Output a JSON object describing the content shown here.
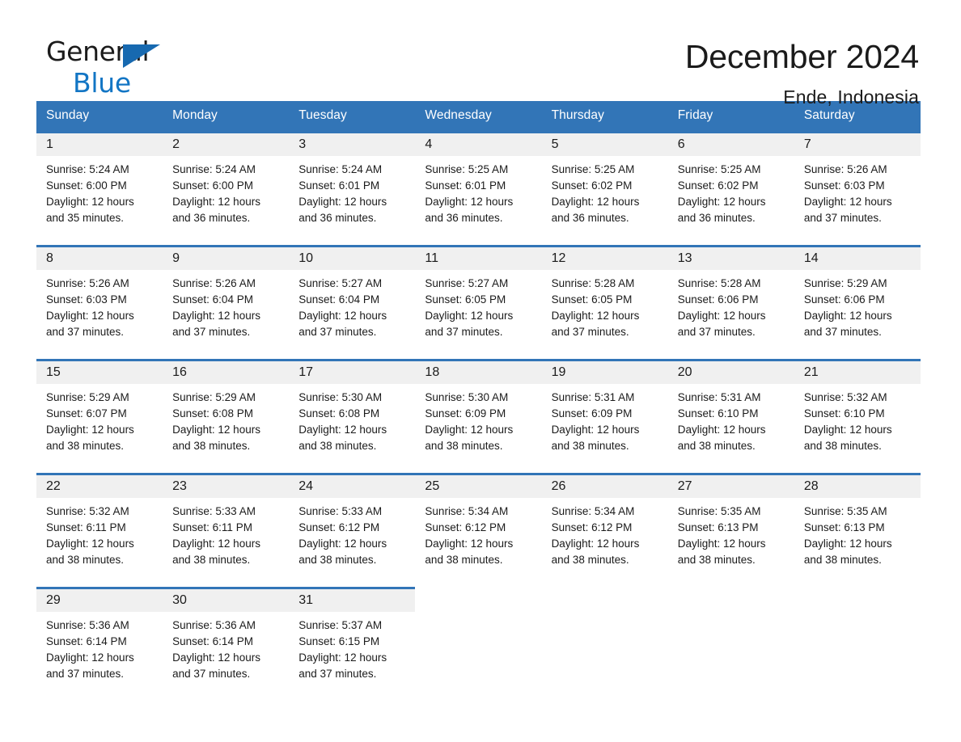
{
  "brand": {
    "name_top": "General",
    "name_bottom": "Blue",
    "accent_color": "#1275c4",
    "triangle_color": "#1769b0"
  },
  "header": {
    "month_title": "December 2024",
    "location": "Ende, Indonesia"
  },
  "calendar": {
    "header_bg": "#3275b7",
    "header_text_color": "#ffffff",
    "daynum_bg": "#f0f0f0",
    "weekdays": [
      "Sunday",
      "Monday",
      "Tuesday",
      "Wednesday",
      "Thursday",
      "Friday",
      "Saturday"
    ],
    "weeks": [
      [
        {
          "day": "1",
          "sunrise": "Sunrise: 5:24 AM",
          "sunset": "Sunset: 6:00 PM",
          "daylight_line1": "Daylight: 12 hours",
          "daylight_line2": "and 35 minutes."
        },
        {
          "day": "2",
          "sunrise": "Sunrise: 5:24 AM",
          "sunset": "Sunset: 6:00 PM",
          "daylight_line1": "Daylight: 12 hours",
          "daylight_line2": "and 36 minutes."
        },
        {
          "day": "3",
          "sunrise": "Sunrise: 5:24 AM",
          "sunset": "Sunset: 6:01 PM",
          "daylight_line1": "Daylight: 12 hours",
          "daylight_line2": "and 36 minutes."
        },
        {
          "day": "4",
          "sunrise": "Sunrise: 5:25 AM",
          "sunset": "Sunset: 6:01 PM",
          "daylight_line1": "Daylight: 12 hours",
          "daylight_line2": "and 36 minutes."
        },
        {
          "day": "5",
          "sunrise": "Sunrise: 5:25 AM",
          "sunset": "Sunset: 6:02 PM",
          "daylight_line1": "Daylight: 12 hours",
          "daylight_line2": "and 36 minutes."
        },
        {
          "day": "6",
          "sunrise": "Sunrise: 5:25 AM",
          "sunset": "Sunset: 6:02 PM",
          "daylight_line1": "Daylight: 12 hours",
          "daylight_line2": "and 36 minutes."
        },
        {
          "day": "7",
          "sunrise": "Sunrise: 5:26 AM",
          "sunset": "Sunset: 6:03 PM",
          "daylight_line1": "Daylight: 12 hours",
          "daylight_line2": "and 37 minutes."
        }
      ],
      [
        {
          "day": "8",
          "sunrise": "Sunrise: 5:26 AM",
          "sunset": "Sunset: 6:03 PM",
          "daylight_line1": "Daylight: 12 hours",
          "daylight_line2": "and 37 minutes."
        },
        {
          "day": "9",
          "sunrise": "Sunrise: 5:26 AM",
          "sunset": "Sunset: 6:04 PM",
          "daylight_line1": "Daylight: 12 hours",
          "daylight_line2": "and 37 minutes."
        },
        {
          "day": "10",
          "sunrise": "Sunrise: 5:27 AM",
          "sunset": "Sunset: 6:04 PM",
          "daylight_line1": "Daylight: 12 hours",
          "daylight_line2": "and 37 minutes."
        },
        {
          "day": "11",
          "sunrise": "Sunrise: 5:27 AM",
          "sunset": "Sunset: 6:05 PM",
          "daylight_line1": "Daylight: 12 hours",
          "daylight_line2": "and 37 minutes."
        },
        {
          "day": "12",
          "sunrise": "Sunrise: 5:28 AM",
          "sunset": "Sunset: 6:05 PM",
          "daylight_line1": "Daylight: 12 hours",
          "daylight_line2": "and 37 minutes."
        },
        {
          "day": "13",
          "sunrise": "Sunrise: 5:28 AM",
          "sunset": "Sunset: 6:06 PM",
          "daylight_line1": "Daylight: 12 hours",
          "daylight_line2": "and 37 minutes."
        },
        {
          "day": "14",
          "sunrise": "Sunrise: 5:29 AM",
          "sunset": "Sunset: 6:06 PM",
          "daylight_line1": "Daylight: 12 hours",
          "daylight_line2": "and 37 minutes."
        }
      ],
      [
        {
          "day": "15",
          "sunrise": "Sunrise: 5:29 AM",
          "sunset": "Sunset: 6:07 PM",
          "daylight_line1": "Daylight: 12 hours",
          "daylight_line2": "and 38 minutes."
        },
        {
          "day": "16",
          "sunrise": "Sunrise: 5:29 AM",
          "sunset": "Sunset: 6:08 PM",
          "daylight_line1": "Daylight: 12 hours",
          "daylight_line2": "and 38 minutes."
        },
        {
          "day": "17",
          "sunrise": "Sunrise: 5:30 AM",
          "sunset": "Sunset: 6:08 PM",
          "daylight_line1": "Daylight: 12 hours",
          "daylight_line2": "and 38 minutes."
        },
        {
          "day": "18",
          "sunrise": "Sunrise: 5:30 AM",
          "sunset": "Sunset: 6:09 PM",
          "daylight_line1": "Daylight: 12 hours",
          "daylight_line2": "and 38 minutes."
        },
        {
          "day": "19",
          "sunrise": "Sunrise: 5:31 AM",
          "sunset": "Sunset: 6:09 PM",
          "daylight_line1": "Daylight: 12 hours",
          "daylight_line2": "and 38 minutes."
        },
        {
          "day": "20",
          "sunrise": "Sunrise: 5:31 AM",
          "sunset": "Sunset: 6:10 PM",
          "daylight_line1": "Daylight: 12 hours",
          "daylight_line2": "and 38 minutes."
        },
        {
          "day": "21",
          "sunrise": "Sunrise: 5:32 AM",
          "sunset": "Sunset: 6:10 PM",
          "daylight_line1": "Daylight: 12 hours",
          "daylight_line2": "and 38 minutes."
        }
      ],
      [
        {
          "day": "22",
          "sunrise": "Sunrise: 5:32 AM",
          "sunset": "Sunset: 6:11 PM",
          "daylight_line1": "Daylight: 12 hours",
          "daylight_line2": "and 38 minutes."
        },
        {
          "day": "23",
          "sunrise": "Sunrise: 5:33 AM",
          "sunset": "Sunset: 6:11 PM",
          "daylight_line1": "Daylight: 12 hours",
          "daylight_line2": "and 38 minutes."
        },
        {
          "day": "24",
          "sunrise": "Sunrise: 5:33 AM",
          "sunset": "Sunset: 6:12 PM",
          "daylight_line1": "Daylight: 12 hours",
          "daylight_line2": "and 38 minutes."
        },
        {
          "day": "25",
          "sunrise": "Sunrise: 5:34 AM",
          "sunset": "Sunset: 6:12 PM",
          "daylight_line1": "Daylight: 12 hours",
          "daylight_line2": "and 38 minutes."
        },
        {
          "day": "26",
          "sunrise": "Sunrise: 5:34 AM",
          "sunset": "Sunset: 6:12 PM",
          "daylight_line1": "Daylight: 12 hours",
          "daylight_line2": "and 38 minutes."
        },
        {
          "day": "27",
          "sunrise": "Sunrise: 5:35 AM",
          "sunset": "Sunset: 6:13 PM",
          "daylight_line1": "Daylight: 12 hours",
          "daylight_line2": "and 38 minutes."
        },
        {
          "day": "28",
          "sunrise": "Sunrise: 5:35 AM",
          "sunset": "Sunset: 6:13 PM",
          "daylight_line1": "Daylight: 12 hours",
          "daylight_line2": "and 38 minutes."
        }
      ],
      [
        {
          "day": "29",
          "sunrise": "Sunrise: 5:36 AM",
          "sunset": "Sunset: 6:14 PM",
          "daylight_line1": "Daylight: 12 hours",
          "daylight_line2": "and 37 minutes."
        },
        {
          "day": "30",
          "sunrise": "Sunrise: 5:36 AM",
          "sunset": "Sunset: 6:14 PM",
          "daylight_line1": "Daylight: 12 hours",
          "daylight_line2": "and 37 minutes."
        },
        {
          "day": "31",
          "sunrise": "Sunrise: 5:37 AM",
          "sunset": "Sunset: 6:15 PM",
          "daylight_line1": "Daylight: 12 hours",
          "daylight_line2": "and 37 minutes."
        },
        {
          "day": "",
          "sunrise": "",
          "sunset": "",
          "daylight_line1": "",
          "daylight_line2": ""
        },
        {
          "day": "",
          "sunrise": "",
          "sunset": "",
          "daylight_line1": "",
          "daylight_line2": ""
        },
        {
          "day": "",
          "sunrise": "",
          "sunset": "",
          "daylight_line1": "",
          "daylight_line2": ""
        },
        {
          "day": "",
          "sunrise": "",
          "sunset": "",
          "daylight_line1": "",
          "daylight_line2": ""
        }
      ]
    ]
  }
}
